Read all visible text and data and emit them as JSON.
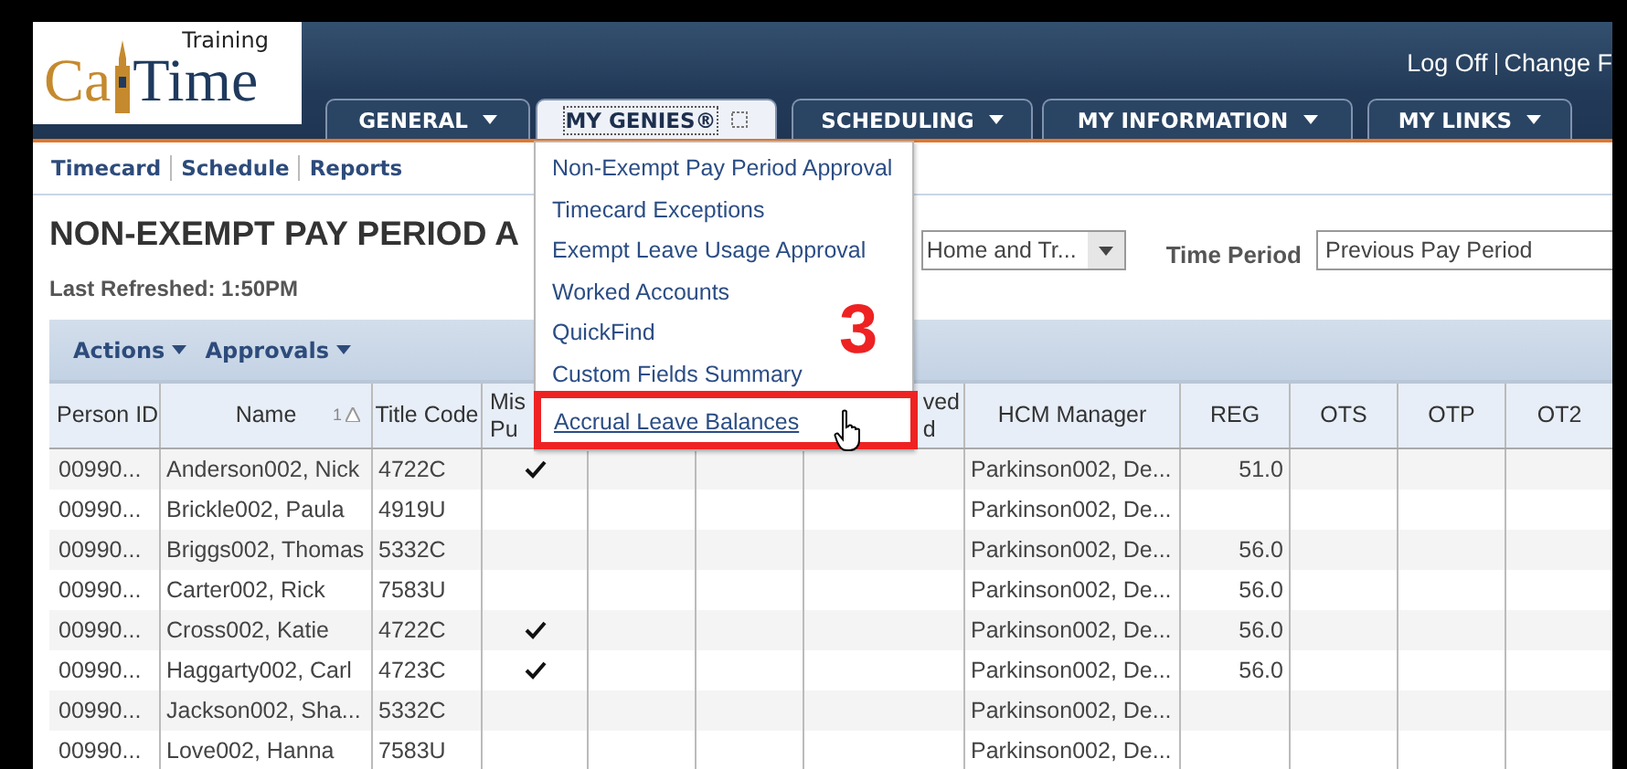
{
  "logo": {
    "part1": "Ca",
    "part2": "Time",
    "edition": "Training"
  },
  "header_links": [
    "Log Off",
    "Change F"
  ],
  "tabs": [
    {
      "label": "GENERAL",
      "kind": "menu",
      "selected": false
    },
    {
      "label": "MY GENIES®",
      "kind": "toggle",
      "selected": true
    },
    {
      "label": "SCHEDULING",
      "kind": "menu",
      "selected": false
    },
    {
      "label": "MY INFORMATION",
      "kind": "menu",
      "selected": false
    },
    {
      "label": "MY LINKS",
      "kind": "menu",
      "selected": false
    }
  ],
  "subnav": [
    "Timecard",
    "Schedule",
    "Reports"
  ],
  "page_title": "NON-EXEMPT PAY PERIOD A",
  "last_refreshed": "Last Refreshed: 1:50PM",
  "filters": {
    "location_select": {
      "value": "Home and Tr..."
    },
    "time_period": {
      "label": "Time Period",
      "value": "Previous Pay Period"
    }
  },
  "toolbar": [
    "Actions",
    "Approvals"
  ],
  "table": {
    "columns": [
      {
        "lines": [
          "Person ID"
        ]
      },
      {
        "lines": [
          "Name"
        ],
        "sort_rank": "1"
      },
      {
        "lines": [
          "Title Code"
        ]
      },
      {
        "lines": [
          "Mis",
          "Pu"
        ]
      },
      {},
      {},
      {
        "lines": [
          "ved",
          "d"
        ]
      },
      {
        "lines": [
          "HCM Manager"
        ]
      },
      {
        "lines": [
          "REG"
        ]
      },
      {
        "lines": [
          "OTS"
        ]
      },
      {
        "lines": [
          "OTP"
        ]
      },
      {
        "lines": [
          "OT2"
        ]
      }
    ],
    "rows": [
      {
        "person_id": "00990...",
        "name": "Anderson002, Nick",
        "title_code": "4722C",
        "checked": true,
        "hcm_manager": "Parkinson002, De...",
        "reg": "51.0"
      },
      {
        "person_id": "00990...",
        "name": "Brickle002, Paula",
        "title_code": "4919U",
        "checked": false,
        "hcm_manager": "Parkinson002, De..."
      },
      {
        "person_id": "00990...",
        "name": "Briggs002, Thomas",
        "title_code": "5332C",
        "checked": false,
        "hcm_manager": "Parkinson002, De...",
        "reg": "56.0"
      },
      {
        "person_id": "00990...",
        "name": "Carter002, Rick",
        "title_code": "7583U",
        "checked": false,
        "hcm_manager": "Parkinson002, De...",
        "reg": "56.0"
      },
      {
        "person_id": "00990...",
        "name": "Cross002, Katie",
        "title_code": "4722C",
        "checked": true,
        "hcm_manager": "Parkinson002, De...",
        "reg": "56.0"
      },
      {
        "person_id": "00990...",
        "name": "Haggarty002, Carl",
        "title_code": "4723C",
        "checked": true,
        "hcm_manager": "Parkinson002, De...",
        "reg": "56.0"
      },
      {
        "person_id": "00990...",
        "name": "Jackson002, Sha...",
        "title_code": "5332C",
        "checked": false,
        "hcm_manager": "Parkinson002, De..."
      },
      {
        "person_id": "00990...",
        "name": "Love002, Hanna",
        "title_code": "7583U",
        "checked": false,
        "hcm_manager": "Parkinson002, De..."
      }
    ]
  },
  "dropdown_menu": {
    "items": [
      {
        "label": "Non-Exempt Pay Period Approval",
        "selected": false
      },
      {
        "label": "Timecard Exceptions",
        "selected": false
      },
      {
        "label": "Exempt Leave Usage Approval",
        "selected": false
      },
      {
        "label": "Worked Accounts",
        "selected": false
      },
      {
        "label": "QuickFind",
        "selected": false
      },
      {
        "label": "Custom Fields Summary",
        "selected": false
      },
      {
        "label": "Accrual Leave Balances",
        "selected": true
      }
    ]
  },
  "annotation": {
    "step": "3"
  }
}
